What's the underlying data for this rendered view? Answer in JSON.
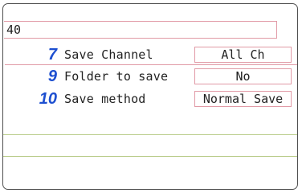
{
  "header": {
    "top_field_value": "40"
  },
  "settings": [
    {
      "number": "7",
      "label": "Save Channel",
      "value": "All Ch"
    },
    {
      "number": "9",
      "label": "Folder to save",
      "value": "No"
    },
    {
      "number": "10",
      "label": "Save method",
      "value": "Normal Save"
    }
  ],
  "colors": {
    "number_accent": "#1d4fd0",
    "field_border": "#e19aa6",
    "separator_line": "#b9cc8a"
  }
}
